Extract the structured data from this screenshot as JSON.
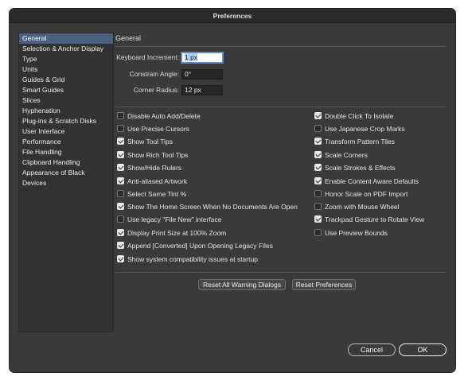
{
  "window": {
    "title": "Preferences"
  },
  "sidebar": {
    "items": [
      {
        "label": "General",
        "selected": true
      },
      {
        "label": "Selection & Anchor Display"
      },
      {
        "label": "Type"
      },
      {
        "label": "Units"
      },
      {
        "label": "Guides & Grid"
      },
      {
        "label": "Smart Guides"
      },
      {
        "label": "Slices"
      },
      {
        "label": "Hyphenation"
      },
      {
        "label": "Plug-ins & Scratch Disks"
      },
      {
        "label": "User Interface"
      },
      {
        "label": "Performance"
      },
      {
        "label": "File Handling"
      },
      {
        "label": "Clipboard Handling"
      },
      {
        "label": "Appearance of Black"
      },
      {
        "label": "Devices"
      }
    ]
  },
  "general": {
    "section_title": "General",
    "keyboard_increment": {
      "label": "Keyboard Increment:",
      "value": "1 px"
    },
    "constrain_angle": {
      "label": "Constrain Angle:",
      "value": "0°"
    },
    "corner_radius": {
      "label": "Corner Radius:",
      "value": "12 px"
    }
  },
  "options_left": [
    {
      "label": "Disable Auto Add/Delete",
      "checked": false
    },
    {
      "label": "Use Precise Cursors",
      "checked": false
    },
    {
      "label": "Show Tool Tips",
      "checked": true
    },
    {
      "label": "Show Rich Tool Tips",
      "checked": true
    },
    {
      "label": "Show/Hide Rulers",
      "checked": true
    },
    {
      "label": "Anti-aliased Artwork",
      "checked": true
    },
    {
      "label": "Select Same Tint %",
      "checked": false
    },
    {
      "label": "Show The Home Screen When No Documents Are Open",
      "checked": true
    },
    {
      "label": "Use legacy \"File New\" interface",
      "checked": false
    },
    {
      "label": "Display Print Size at 100% Zoom",
      "checked": true
    },
    {
      "label": "Append [Converted] Upon Opening Legacy Files",
      "checked": true
    },
    {
      "label": "Show system compatibility issues at startup",
      "checked": true
    }
  ],
  "options_right": [
    {
      "label": "Double Click To Isolate",
      "checked": true
    },
    {
      "label": "Use Japanese Crop Marks",
      "checked": false
    },
    {
      "label": "Transform Pattern Tiles",
      "checked": true
    },
    {
      "label": "Scale Corners",
      "checked": true
    },
    {
      "label": "Scale Strokes & Effects",
      "checked": true
    },
    {
      "label": "Enable Content Aware Defaults",
      "checked": true
    },
    {
      "label": "Honor Scale on PDF Import",
      "checked": false
    },
    {
      "label": "Zoom with Mouse Wheel",
      "checked": false
    },
    {
      "label": "Trackpad Gesture to Rotate View",
      "checked": true
    },
    {
      "label": "Use Preview Bounds",
      "checked": false
    }
  ],
  "actions": {
    "reset_warnings": "Reset All Warning Dialogs",
    "reset_preferences": "Reset Preferences",
    "cancel": "Cancel",
    "ok": "OK"
  }
}
